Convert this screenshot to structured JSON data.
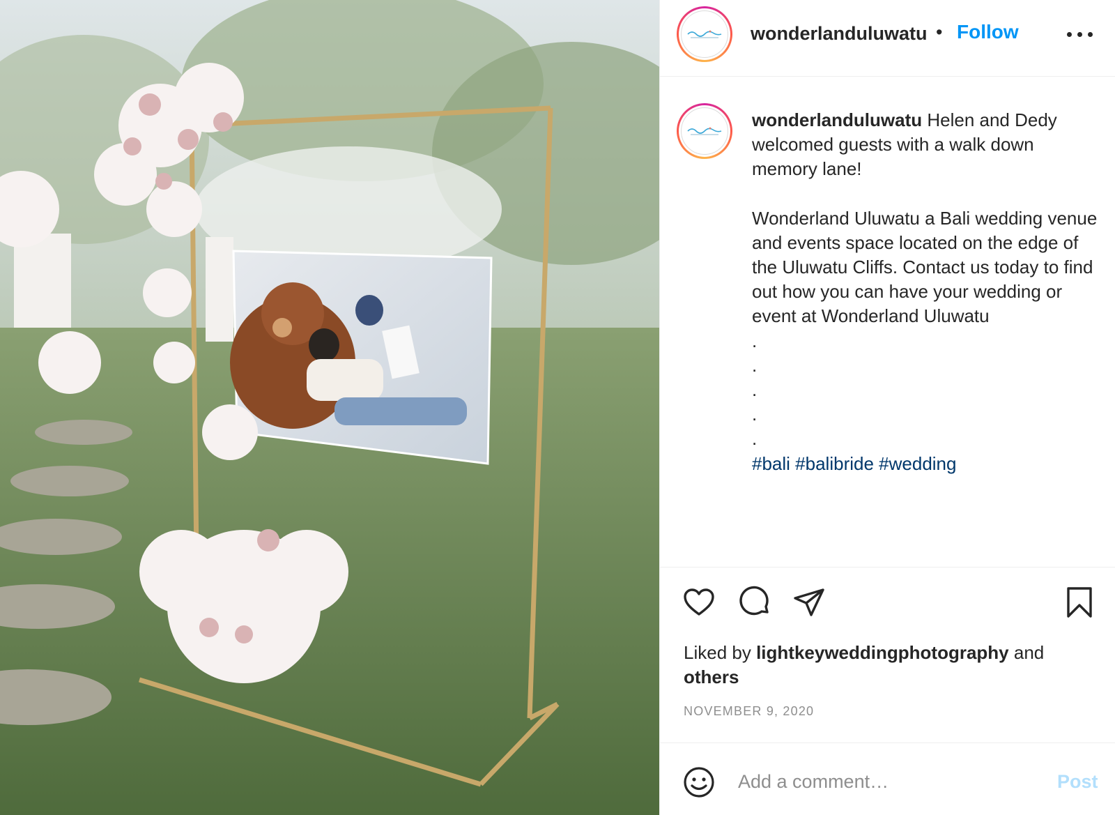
{
  "post": {
    "photo_icon": "wedding-photo-display"
  },
  "header": {
    "username": "wonderlanduluwatu",
    "separator": "•",
    "follow_label": "Follow",
    "more_icon": "more-options-icon"
  },
  "caption": {
    "username": "wonderlanduluwatu",
    "line1": "Helen and Dedy welcomed guests with a walk down memory lane!",
    "line2": "Wonderland Uluwatu a Bali wedding venue and events space located on the edge of the Uluwatu Cliffs. Contact us today to find out how you can have your wedding or event at Wonderland Uluwatu",
    "dots": [
      ".",
      ".",
      ".",
      ".",
      "."
    ],
    "hashtags": [
      "#bali",
      "#balibride",
      "#wedding"
    ]
  },
  "actions": {
    "like_icon": "heart-icon",
    "comment_icon": "comment-icon",
    "share_icon": "paper-plane-icon",
    "save_icon": "bookmark-icon"
  },
  "likes": {
    "prefix": "Liked by",
    "user": "lightkeyweddingphotography",
    "conjunction": "and",
    "others": "others"
  },
  "date": "NOVEMBER 9, 2020",
  "comment": {
    "emoji_icon": "smiley-icon",
    "placeholder": "Add a comment…",
    "post_label": "Post"
  },
  "colors": {
    "link_blue": "#0095f6",
    "hashtag": "#00376b",
    "post_disabled": "#b2dffc",
    "muted": "#8e8e8e"
  }
}
